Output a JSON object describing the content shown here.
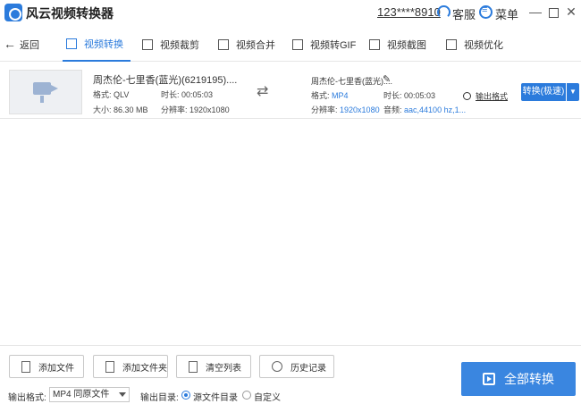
{
  "app": {
    "title": "风云视频转换器",
    "account": "123****8910",
    "service_label": "客服",
    "menu_label": "菜单",
    "min_symbol": "—",
    "close_symbol": "✕"
  },
  "nav": {
    "back_label": "返回",
    "tabs": [
      {
        "label": "视频转换",
        "active": true,
        "icon": "video-convert-icon"
      },
      {
        "label": "视频裁剪",
        "icon": "video-crop-icon"
      },
      {
        "label": "视频合并",
        "icon": "video-merge-icon"
      },
      {
        "label": "视频转GIF",
        "icon": "gif-icon"
      },
      {
        "label": "视频截图",
        "icon": "screenshot-icon"
      },
      {
        "label": "视频优化",
        "icon": "sliders-icon"
      }
    ]
  },
  "task": {
    "source": {
      "name": "周杰伦-七里香(蓝光)(6219195)....",
      "format_label": "格式:",
      "format": "QLV",
      "duration_label": "时长:",
      "duration": "00:05:03",
      "size_label": "大小:",
      "size": "86.30 MB",
      "resolution_label": "分辨率:",
      "resolution": "1920x1080"
    },
    "target": {
      "name": "周杰伦-七里香(蓝光)....",
      "format_label": "格式:",
      "format": "MP4",
      "duration_label": "时长:",
      "duration": "00:05:03",
      "resolution_label": "分辨率:",
      "resolution": "1920x1080",
      "audio_label": "音频:",
      "audio": "aac,44100 hz,1..."
    },
    "output_format_link": "输出格式",
    "convert_button": "转换(极速)",
    "convert_dropdown": "▼"
  },
  "bottom": {
    "add_file": "添加文件",
    "add_folder": "添加文件夹",
    "clear_list": "清空列表",
    "history": "历史记录",
    "convert_all": "全部转换",
    "output_format_label": "输出格式:",
    "output_format_value": "MP4 同原文件",
    "output_dir_label": "输出目录:",
    "dir_options": [
      {
        "label": "源文件目录",
        "selected": true
      },
      {
        "label": "自定义",
        "selected": false
      }
    ]
  },
  "colors": {
    "accent": "#2b7bdc",
    "big_button": "#3a86e0"
  }
}
